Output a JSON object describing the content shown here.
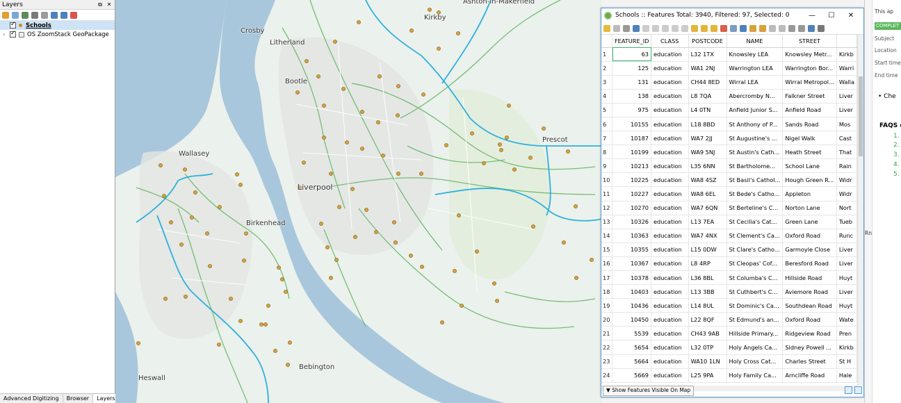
{
  "layers_panel": {
    "title": "Layers",
    "layers": [
      {
        "label": "Schools",
        "checked": true,
        "selected": true
      },
      {
        "label": "OS ZoomStack GeoPackage",
        "checked": true,
        "selected": false
      }
    ],
    "bottom_tabs": [
      "Advanced Digitizing",
      "Browser",
      "Layers"
    ]
  },
  "map": {
    "places": [
      "Ashton-in-Makerfield",
      "Kirkby",
      "Crosby",
      "Litherland",
      "Bootle",
      "Prescot",
      "Wallasey",
      "Liverpool",
      "Birkenhead",
      "Bebington",
      "Heswall"
    ],
    "colors": {
      "water": "#a9c7dc",
      "land": "#ebf1ec",
      "motorway": "#2eb0e0",
      "roads": "#69b86a",
      "school": "#d6a23a"
    }
  },
  "attribute_table": {
    "title": "Schools :: Features Total: 3940, Filtered: 97, Selected: 0",
    "window_buttons": [
      "—",
      "☐",
      "✕"
    ],
    "columns": [
      "FEATURE_ID",
      "CLASS",
      "POSTCODE",
      "NAME",
      "STREET",
      ""
    ],
    "rows": [
      [
        "1",
        "63",
        "education",
        "L32 1TX",
        "Knowsley LEA",
        "Knowsley Metr...",
        "Kirkb"
      ],
      [
        "2",
        "125",
        "education",
        "WA1 2NJ",
        "Warrington LEA",
        "Warrington Bor...",
        "Warri"
      ],
      [
        "3",
        "131",
        "education",
        "CH44 8ED",
        "Wirral LEA",
        "Wirral Metropol...",
        "Walla"
      ],
      [
        "4",
        "138",
        "education",
        "L8 7QA",
        "Abercromby N...",
        "Falkner Street",
        "Liver"
      ],
      [
        "5",
        "975",
        "education",
        "L4 0TN",
        "Anfield Junior S...",
        "Anfield Road",
        "Liver"
      ],
      [
        "6",
        "10155",
        "education",
        "L18 8BD",
        "St Anthony of P...",
        "Sands Road",
        "Mos"
      ],
      [
        "7",
        "10187",
        "education",
        "WA7 2JJ",
        "St Augustine's ...",
        "Nigel Walk",
        "Cast"
      ],
      [
        "8",
        "10199",
        "education",
        "WA9 5NJ",
        "St Austin's Cath...",
        "Heath Street",
        "That"
      ],
      [
        "9",
        "10213",
        "education",
        "L35 6NN",
        "St Bartholome...",
        "School Lane",
        "Rain"
      ],
      [
        "10",
        "10225",
        "education",
        "WA8 4SZ",
        "St Basil's Cathol...",
        "Hough Green R...",
        "Widr"
      ],
      [
        "11",
        "10227",
        "education",
        "WA8 6EL",
        "St Bede's Catho...",
        "Appleton",
        "Widr"
      ],
      [
        "12",
        "10270",
        "education",
        "WA7 6QN",
        "St Berteline's C...",
        "Norton Lane",
        "Nort"
      ],
      [
        "13",
        "10326",
        "education",
        "L13 7EA",
        "St Cecilia's Cat...",
        "Green Lane",
        "Tueb"
      ],
      [
        "14",
        "10363",
        "education",
        "WA7 4NX",
        "St Clement's Ca...",
        "Oxford Road",
        "Runc"
      ],
      [
        "15",
        "10355",
        "education",
        "L15 0DW",
        "St Clare's Catho...",
        "Garmoyle Close",
        "Liver"
      ],
      [
        "16",
        "10367",
        "education",
        "L8 4RP",
        "St Cleopas' Cof...",
        "Beresford Road",
        "Liver"
      ],
      [
        "17",
        "10378",
        "education",
        "L36 8BL",
        "St Columba's C...",
        "Hillside Road",
        "Huyt"
      ],
      [
        "18",
        "10403",
        "education",
        "L13 3BB",
        "St Cuthbert's C...",
        "Aviemore Road",
        "Liver"
      ],
      [
        "19",
        "10436",
        "education",
        "L14 8UL",
        "St Dominic's Ca...",
        "Southdean Road",
        "Huyt"
      ],
      [
        "20",
        "10450",
        "education",
        "L22 8QF",
        "St Edmund's an...",
        "Oxford Road",
        "Wate"
      ],
      [
        "21",
        "5539",
        "education",
        "CH43 9AB",
        "Hillside Primary...",
        "Ridgeview Road",
        "Pren"
      ],
      [
        "22",
        "5654",
        "education",
        "L32 0TP",
        "Holy Angels Ca...",
        "Sidney Powell ...",
        "Kirkb"
      ],
      [
        "23",
        "5664",
        "education",
        "WA10 1LN",
        "Holy Cross Cat...",
        "Charles Street",
        "St H"
      ],
      [
        "24",
        "5669",
        "education",
        "L25 9PA",
        "Holy Family Ca...",
        "Arncliffe Road",
        "Hale"
      ]
    ],
    "footer_button": "Show Features Visible On Map"
  },
  "right_panel": {
    "header": "This ap",
    "badge": "COMPLET",
    "fields": [
      "Subject",
      "Location",
      "Start time",
      "End time"
    ],
    "bullet": "Che",
    "faqs": "FAQS d",
    "faq_numbers": [
      "1.",
      "2.",
      "3.",
      "4.",
      "5."
    ],
    "side_label": "Rn"
  }
}
